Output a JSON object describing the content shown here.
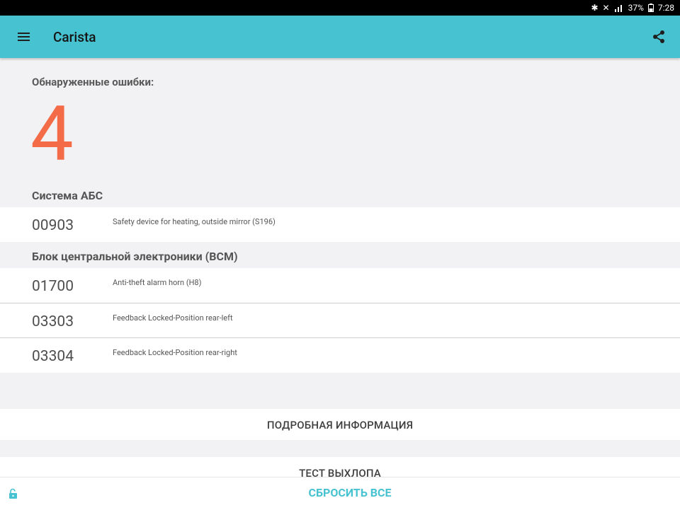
{
  "status": {
    "bluetooth": "✱",
    "mute": "✕",
    "battery": "37%",
    "time": "7:28"
  },
  "appbar": {
    "title": "Carista"
  },
  "summary": {
    "label": "Обнаруженные ошибки:",
    "count": "4"
  },
  "sections": [
    {
      "title": "Система АБС",
      "faults": [
        {
          "code": "00903",
          "description": "Safety device for heating, outside mirror (S196)"
        }
      ]
    },
    {
      "title": "Блок центральной электроники (BCM)",
      "faults": [
        {
          "code": "01700",
          "description": "Anti-theft alarm horn (H8)"
        },
        {
          "code": "03303",
          "description": "Feedback Locked-Position rear-left"
        },
        {
          "code": "03304",
          "description": "Feedback Locked-Position rear-right"
        }
      ]
    }
  ],
  "actions": {
    "details": "ПОДРОБНАЯ ИНФОРМАЦИЯ",
    "emissions": "ТЕСТ ВЫХЛОПА",
    "reset": "СБРОСИТЬ ВСЕ"
  },
  "colors": {
    "appbar": "#46c2d1",
    "count": "#f46b47",
    "accent": "#46c2d1"
  }
}
